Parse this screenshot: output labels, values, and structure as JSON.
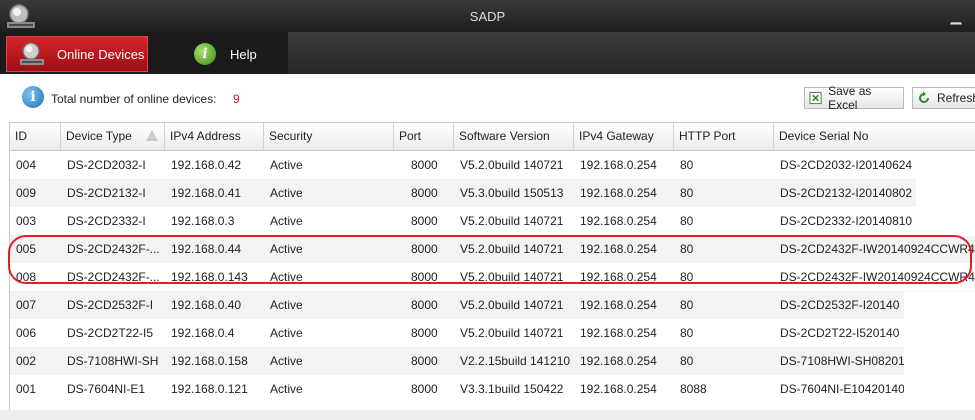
{
  "window": {
    "title": "SADP"
  },
  "tabs": [
    {
      "label": "Online Devices",
      "icon": "devices-icon",
      "active": true
    },
    {
      "label": "Help",
      "icon": "help-icon",
      "active": false
    }
  ],
  "summary": {
    "label": "Total number of online devices:",
    "count": "9",
    "count_color": "#d01818"
  },
  "toolbar": {
    "save_excel_label": "Save as Excel",
    "refresh_label": "Refresh"
  },
  "table": {
    "columns": [
      "ID",
      "Device Type",
      "IPv4 Address",
      "Security",
      "Port",
      "Software Version",
      "IPv4 Gateway",
      "HTTP Port",
      "Device Serial No"
    ],
    "rows": [
      [
        "004",
        "DS-2CD2032-I",
        "192.168.0.42",
        "Active",
        "8000",
        "V5.2.0build 140721",
        "192.168.0.254",
        "80",
        "DS-2CD2032-I20140624"
      ],
      [
        "009",
        "DS-2CD2132-I",
        "192.168.0.41",
        "Active",
        "8000",
        "V5.3.0build 150513",
        "192.168.0.254",
        "80",
        "DS-2CD2132-I20140802"
      ],
      [
        "003",
        "DS-2CD2332-I",
        "192.168.0.3",
        "Active",
        "8000",
        "V5.2.0build 140721",
        "192.168.0.254",
        "80",
        "DS-2CD2332-I20140810"
      ],
      [
        "005",
        "DS-2CD2432F-...",
        "192.168.0.44",
        "Active",
        "8000",
        "V5.2.0build 140721",
        "192.168.0.254",
        "80",
        "DS-2CD2432F-IW20140924CCWR4"
      ],
      [
        "008",
        "DS-2CD2432F-...",
        "192.168.0.143",
        "Active",
        "8000",
        "V5.2.0build 140721",
        "192.168.0.254",
        "80",
        "DS-2CD2432F-IW20140924CCWR4"
      ],
      [
        "007",
        "DS-2CD2532F-I",
        "192.168.0.40",
        "Active",
        "8000",
        "V5.2.0build 140721",
        "192.168.0.254",
        "80",
        "DS-2CD2532F-I20140"
      ],
      [
        "006",
        "DS-2CD2T22-I5",
        "192.168.0.4",
        "Active",
        "8000",
        "V5.2.0build 140721",
        "192.168.0.254",
        "80",
        "DS-2CD2T22-I520140"
      ],
      [
        "002",
        "DS-7108HWI-SH",
        "192.168.0.158",
        "Active",
        "8000",
        "V2.2.15build 141210",
        "192.168.0.254",
        "80",
        "DS-7108HWI-SH08201"
      ],
      [
        "001",
        "DS-7604NI-E1",
        "192.168.0.121",
        "Active",
        "8000",
        "V3.3.1build 150422",
        "192.168.0.254",
        "8088",
        "DS-7604NI-E10420140"
      ]
    ]
  }
}
